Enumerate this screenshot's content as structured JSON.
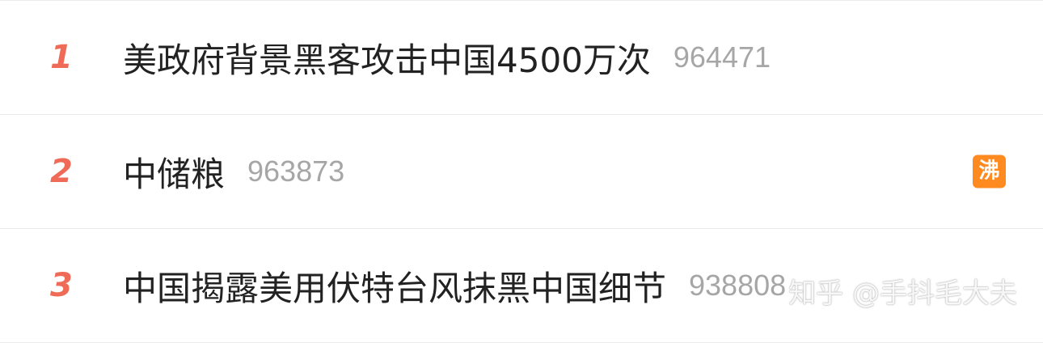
{
  "hot_list": {
    "items": [
      {
        "rank": "1",
        "title": "美政府背景黑客攻击中国4500万次",
        "count": "964471",
        "badge": ""
      },
      {
        "rank": "2",
        "title": "中储粮",
        "count": "963873",
        "badge": "沸"
      },
      {
        "rank": "3",
        "title": "中国揭露美用伏特台风抹黑中国细节",
        "count": "938808",
        "badge": ""
      }
    ]
  },
  "watermark": "知乎 @手抖毛大夫",
  "colors": {
    "rank": "#ef6b57",
    "count": "#a6a6a6",
    "badge": "#ff8a1f",
    "divider": "#ebebeb"
  }
}
